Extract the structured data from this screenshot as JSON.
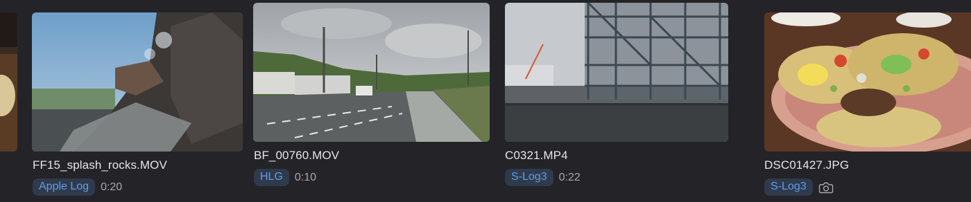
{
  "clips": [
    {
      "filename": "",
      "format": "",
      "duration": "",
      "thumb_icon": "partial-thumbnail"
    },
    {
      "filename": "FF15_splash_rocks.MOV",
      "format": "Apple Log",
      "duration": "0:20",
      "thumb_icon": "waterfall-rocks-thumbnail"
    },
    {
      "filename": "BF_00760.MOV",
      "format": "HLG",
      "duration": "0:10",
      "thumb_icon": "road-thumbnail"
    },
    {
      "filename": "C0321.MP4",
      "format": "S-Log3",
      "duration": "0:22",
      "thumb_icon": "construction-thumbnail"
    },
    {
      "filename": "DSC01427.JPG",
      "format": "S-Log3",
      "duration": "",
      "thumb_icon": "tacos-thumbnail",
      "media_type_icon": "camera-icon"
    }
  ],
  "colors": {
    "background": "#242428",
    "badge_bg": "#2f3a4d",
    "badge_text": "#5f9eea"
  }
}
